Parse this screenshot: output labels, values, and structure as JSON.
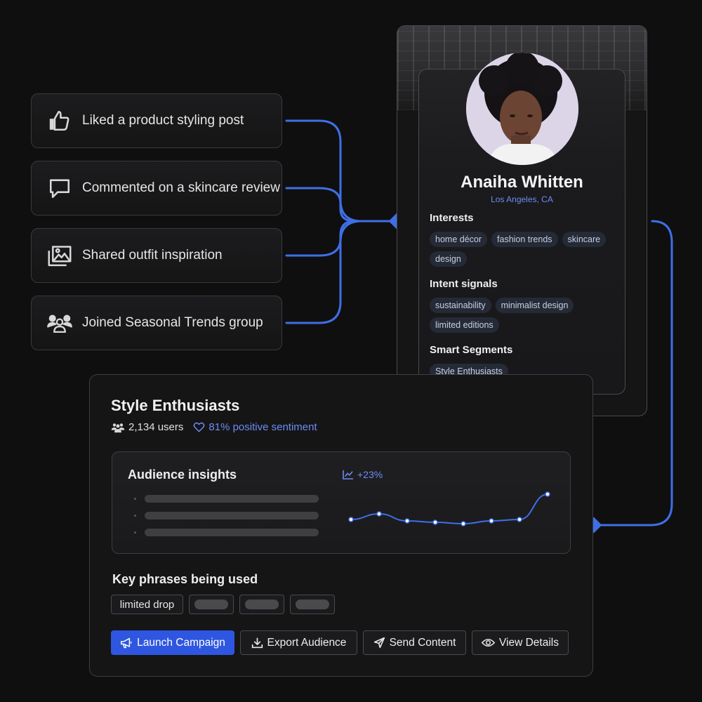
{
  "activities": [
    {
      "icon": "thumbs-up-icon",
      "text": "Liked a product styling post"
    },
    {
      "icon": "comment-icon",
      "text": "Commented on a skincare review"
    },
    {
      "icon": "gallery-icon",
      "text": "Shared outfit inspiration"
    },
    {
      "icon": "group-icon",
      "text": "Joined Seasonal Trends group"
    }
  ],
  "profile": {
    "name": "Anaiha Whitten",
    "location": "Los Angeles, CA",
    "interests_title": "Interests",
    "interests": [
      "home décor",
      "fashion trends",
      "skincare",
      "design"
    ],
    "intent_title": "Intent signals",
    "intent": [
      "sustainability",
      "minimalist design",
      "limited editions"
    ],
    "segments_title": "Smart Segments",
    "segments": [
      "Style Enthusiasts"
    ]
  },
  "segment": {
    "title": "Style Enthusiasts",
    "users": "2,134 users",
    "sentiment": "81% positive sentiment",
    "insights_title": "Audience insights",
    "trend": "+23%",
    "phrases_title": "Key phrases being used",
    "phrases": [
      "limited drop"
    ],
    "buttons": {
      "launch": "Launch Campaign",
      "export": "Export Audience",
      "send": "Send Content",
      "view": "View Details"
    }
  },
  "colors": {
    "accent": "#3f6fe6",
    "primary_button": "#2f56e0",
    "link": "#6f8bf3"
  },
  "chart_data": {
    "type": "line",
    "x": [
      1,
      2,
      3,
      4,
      5,
      6,
      7,
      8
    ],
    "values": [
      45,
      49,
      44,
      43,
      42,
      44,
      45,
      63
    ],
    "ylim": [
      30,
      70
    ],
    "xlabel": "",
    "ylabel": "",
    "grid": false
  }
}
